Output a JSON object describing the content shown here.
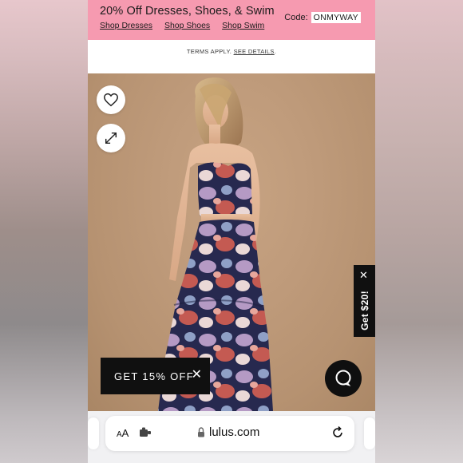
{
  "promo": {
    "title": "20% Off Dresses, Shoes, & Swim",
    "links": [
      "Shop Dresses",
      "Shop Shoes",
      "Shop Swim"
    ],
    "code_label": "Code:",
    "code_value": "ONMYWAY"
  },
  "terms": {
    "text": "TERMS APPLY.",
    "link": "SEE DETAILS",
    "period": "."
  },
  "photo": {
    "wishlist_icon": "heart-icon",
    "expand_icon": "expand-icon"
  },
  "popups": {
    "get20_label": "Get $20!",
    "discount_label": "GET 15% OFF",
    "close_glyph": "✕"
  },
  "chat": {
    "icon": "chat-bubble-icon"
  },
  "browser": {
    "text_size_label_small": "A",
    "text_size_label_large": "A",
    "url": "lulus.com",
    "icons": [
      "text-size-icon",
      "extension-icon",
      "lock-icon",
      "reload-icon"
    ]
  },
  "colors": {
    "promo_bg": "#f69ab0",
    "dark": "#101010",
    "photo_bg": "#bf9b7b",
    "browser_bg": "#f1f1f3"
  }
}
